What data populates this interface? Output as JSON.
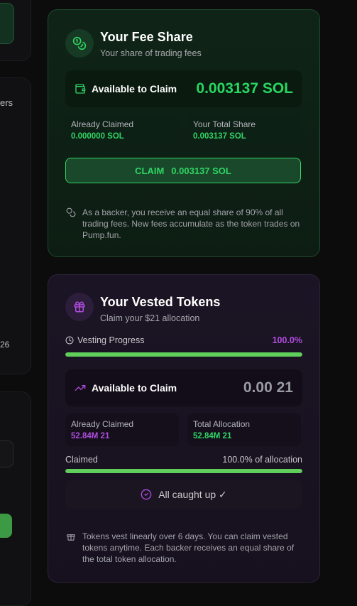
{
  "left_column": {
    "text_1": "ers",
    "text_2": "26"
  },
  "fee_share": {
    "icon": "coins-icon",
    "title": "Your Fee Share",
    "subtitle": "Your share of trading fees",
    "available_label": "Available to Claim",
    "available_amount": "0.003137 SOL",
    "already_claimed_label": "Already Claimed",
    "already_claimed_value": "0.000000 SOL",
    "total_share_label": "Your Total Share",
    "total_share_value": "0.003137 SOL",
    "claim_button_label": "CLAIM",
    "claim_button_amount": "0.003137 SOL",
    "note": "As a backer, you receive an equal share of 90% of all trading fees. New fees accumulate as the token trades on Pump.fun."
  },
  "vested_tokens": {
    "icon": "gift-icon",
    "title": "Your Vested Tokens",
    "subtitle": "Claim your $21 allocation",
    "progress_label": "Vesting Progress",
    "progress_value": "100.0%",
    "progress_fraction": 1.0,
    "available_label": "Available to Claim",
    "available_amount": "0.00 21",
    "already_claimed_label": "Already Claimed",
    "already_claimed_value": "52.84M 21",
    "total_allocation_label": "Total Allocation",
    "total_allocation_value": "52.84M 21",
    "claimed_label": "Claimed",
    "claimed_value": "100.0% of allocation",
    "claimed_fraction": 1.0,
    "status_text": "All caught up ✓",
    "note": "Tokens vest linearly over 6 days. You can claim vested tokens anytime. Each backer receives an equal share of the total token allocation."
  },
  "colors": {
    "accent_green": "#2fd565",
    "accent_purple": "#b04de0",
    "bar_fill": "#5fce5a"
  }
}
